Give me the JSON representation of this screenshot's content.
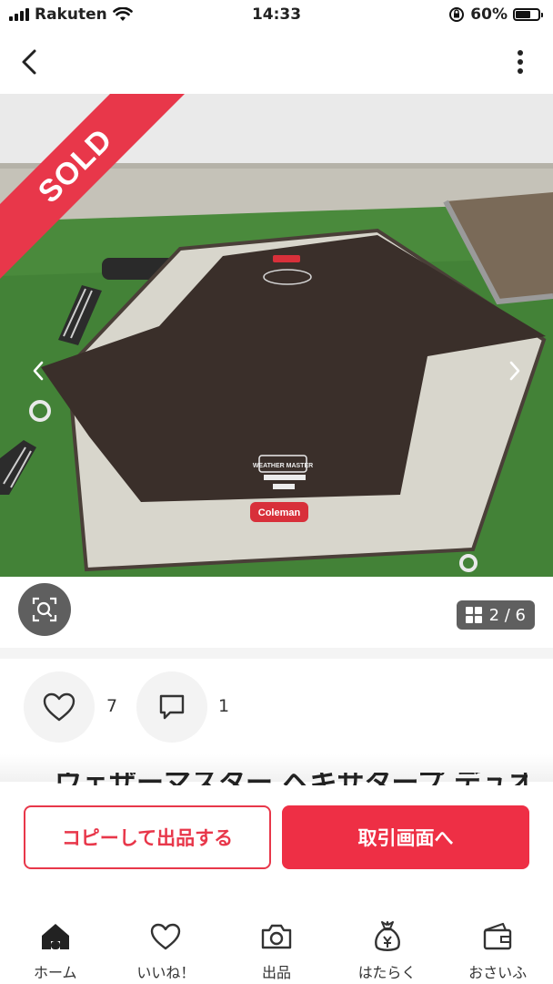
{
  "status_bar": {
    "carrier": "Rakuten",
    "time": "14:33",
    "battery": "60%"
  },
  "photo": {
    "sold_label": "SOLD",
    "counter": "2 / 6",
    "current": 2,
    "total": 6
  },
  "product_marks": {
    "brand": "Coleman",
    "line1": "WEATHER MASTER",
    "line2": "Hexa Tarp Duo",
    "line3": "PRO"
  },
  "actions": {
    "likes": "7",
    "comments": "1"
  },
  "title_peek": "ウェザーマスター ヘキサタープ デュオ プロ",
  "buttons": {
    "copy_listing": "コピーして出品する",
    "go_trade": "取引画面へ"
  },
  "tabs": [
    {
      "label": "ホーム",
      "icon": "home-icon",
      "active": true
    },
    {
      "label": "いいね！",
      "icon": "heart-icon"
    },
    {
      "label": "出品",
      "icon": "camera-icon"
    },
    {
      "label": "はたらく",
      "icon": "money-bag-icon"
    },
    {
      "label": "おさいふ",
      "icon": "wallet-icon"
    }
  ],
  "colors": {
    "accent": "#ee2f45",
    "sold": "#e8374a"
  }
}
